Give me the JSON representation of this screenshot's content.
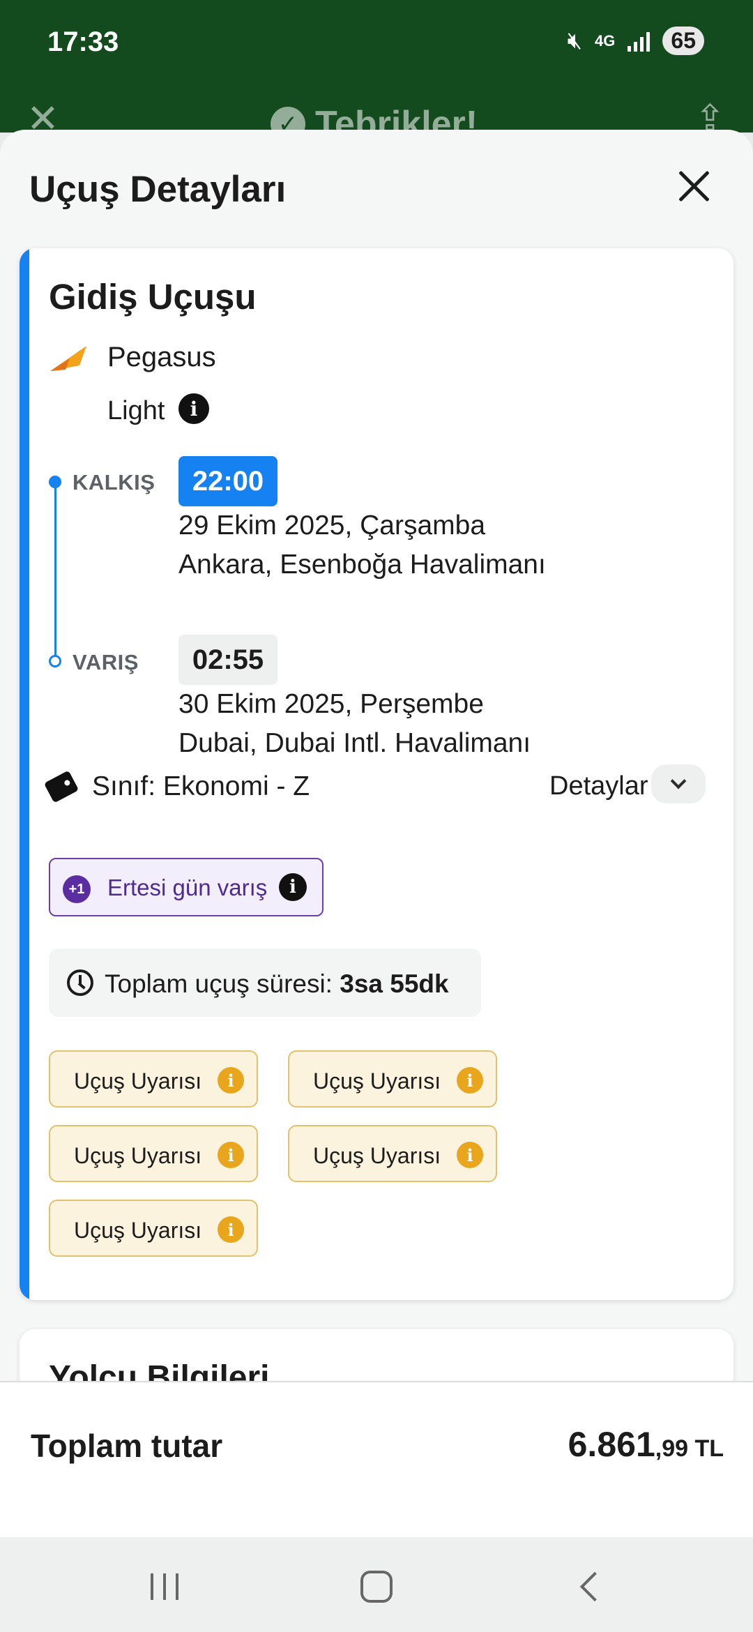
{
  "status_bar": {
    "time": "17:33",
    "network": "4G",
    "battery": "65",
    "icons": [
      "mute-icon",
      "network-4g-icon",
      "signal-icon",
      "battery-icon"
    ]
  },
  "background_header": {
    "title": "Tebrikler!",
    "icons": [
      "close-icon",
      "check-circle-icon",
      "share-icon"
    ]
  },
  "sheet": {
    "title": "Uçuş Detayları",
    "close_icon": "close-icon"
  },
  "flight_card": {
    "title": "Gidiş Uçuşu",
    "accent_color": "#1681f0",
    "airline": "Pegasus",
    "fare": "Light",
    "departure": {
      "label": "KALKIŞ",
      "time": "22:00",
      "date": "29 Ekim 2025, Çarşamba",
      "airport": "Ankara, Esenboğa Havalimanı"
    },
    "arrival": {
      "label": "VARIŞ",
      "time": "02:55",
      "date": "30 Ekim 2025, Perşembe",
      "airport": "Dubai, Dubai Intl. Havalimanı"
    },
    "class_text": "Sınıf: Ekonomi - Z",
    "details_label": "Detaylar",
    "next_day": {
      "badge": "+1",
      "text": "Ertesi gün varış"
    },
    "duration": {
      "label": "Toplam uçuş süresi: ",
      "value": "3sa 55dk"
    },
    "warnings": [
      "Uçuş Uyarısı",
      "Uçuş Uyarısı",
      "Uçuş Uyarısı",
      "Uçuş Uyarısı",
      "Uçuş Uyarısı"
    ]
  },
  "passenger_card": {
    "title": "Yolcu Bilgileri"
  },
  "total": {
    "label": "Toplam tutar",
    "amount_main": "6.861",
    "amount_decimals": ",99 TL"
  },
  "colors": {
    "header_green": "#134b1e",
    "primary_blue": "#1681f0",
    "next_day_purple": "#5a2ea0",
    "warning_orange": "#e9a51c"
  }
}
